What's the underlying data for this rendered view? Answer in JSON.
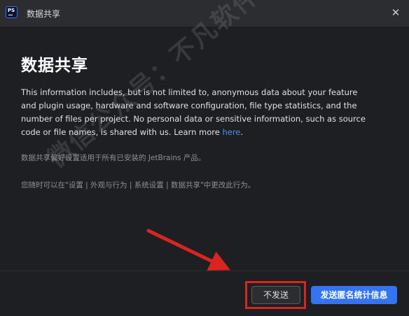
{
  "window": {
    "app_icon_text": "PS",
    "title": "数据共享",
    "close_symbol": "✕"
  },
  "main": {
    "heading": "数据共享",
    "description_text": "This information includes, but is not limited to, anonymous data about your feature and plugin usage, hardware and software configuration, file type statistics, and the number of files per project. No personal data or sensitive information, such as source code or file names, is shared with us. Learn more ",
    "learn_more_link": "here",
    "description_end": ".",
    "note_jetbrains": "数据共享偏好设置适用于所有已安装的 JetBrains 产品。",
    "note_settings": "您随时可以在\"设置 | 外观与行为 | 系统设置 | 数据共享\"中更改此行为。"
  },
  "watermark": {
    "text": "微信公众号：不凡软件库"
  },
  "footer": {
    "decline_label": "不发送",
    "accept_label": "发送匿名统计信息"
  },
  "colors": {
    "background": "#1e1f22",
    "titlebar": "#2b2d30",
    "link": "#548af7",
    "primary_button": "#3574f0",
    "annotation_red": "#d9251f"
  }
}
